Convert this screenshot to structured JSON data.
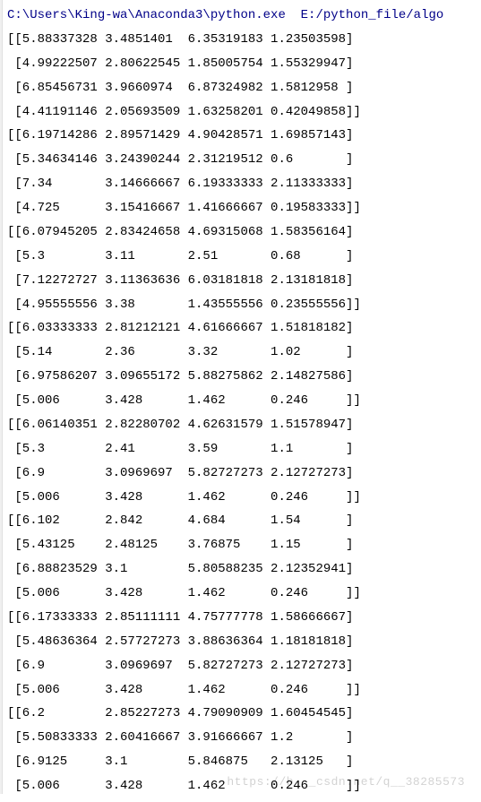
{
  "path_line": "C:\\Users\\King-wa\\Anaconda3\\python.exe  E:/python_file/algo",
  "rows": [
    "[[5.88337328 3.4851401  6.35319183 1.23503598]",
    " [4.99222507 2.80622545 1.85005754 1.55329947]",
    " [6.85456731 3.9660974  6.87324982 1.5812958 ]",
    " [4.41191146 2.05693509 1.63258201 0.42049858]]",
    "[[6.19714286 2.89571429 4.90428571 1.69857143]",
    " [5.34634146 3.24390244 2.31219512 0.6       ]",
    " [7.34       3.14666667 6.19333333 2.11333333]",
    " [4.725      3.15416667 1.41666667 0.19583333]]",
    "[[6.07945205 2.83424658 4.69315068 1.58356164]",
    " [5.3        3.11       2.51       0.68      ]",
    " [7.12272727 3.11363636 6.03181818 2.13181818]",
    " [4.95555556 3.38       1.43555556 0.23555556]]",
    "[[6.03333333 2.81212121 4.61666667 1.51818182]",
    " [5.14       2.36       3.32       1.02      ]",
    " [6.97586207 3.09655172 5.88275862 2.14827586]",
    " [5.006      3.428      1.462      0.246     ]]",
    "[[6.06140351 2.82280702 4.62631579 1.51578947]",
    " [5.3        2.41       3.59       1.1       ]",
    " [6.9        3.0969697  5.82727273 2.12727273]",
    " [5.006      3.428      1.462      0.246     ]]",
    "[[6.102      2.842      4.684      1.54      ]",
    " [5.43125    2.48125    3.76875    1.15      ]",
    " [6.88823529 3.1        5.80588235 2.12352941]",
    " [5.006      3.428      1.462      0.246     ]]",
    "[[6.17333333 2.85111111 4.75777778 1.58666667]",
    " [5.48636364 2.57727273 3.88636364 1.18181818]",
    " [6.9        3.0969697  5.82727273 2.12727273]",
    " [5.006      3.428      1.462      0.246     ]]",
    "[[6.2        2.85227273 4.79090909 1.60454545]",
    " [5.50833333 2.60416667 3.91666667 1.2       ]",
    " [6.9125     3.1        5.846875   2.13125   ]",
    " [5.006      3.428      1.462      0.246     ]]"
  ],
  "watermark": "https://b___csdn.net/q__38285573"
}
